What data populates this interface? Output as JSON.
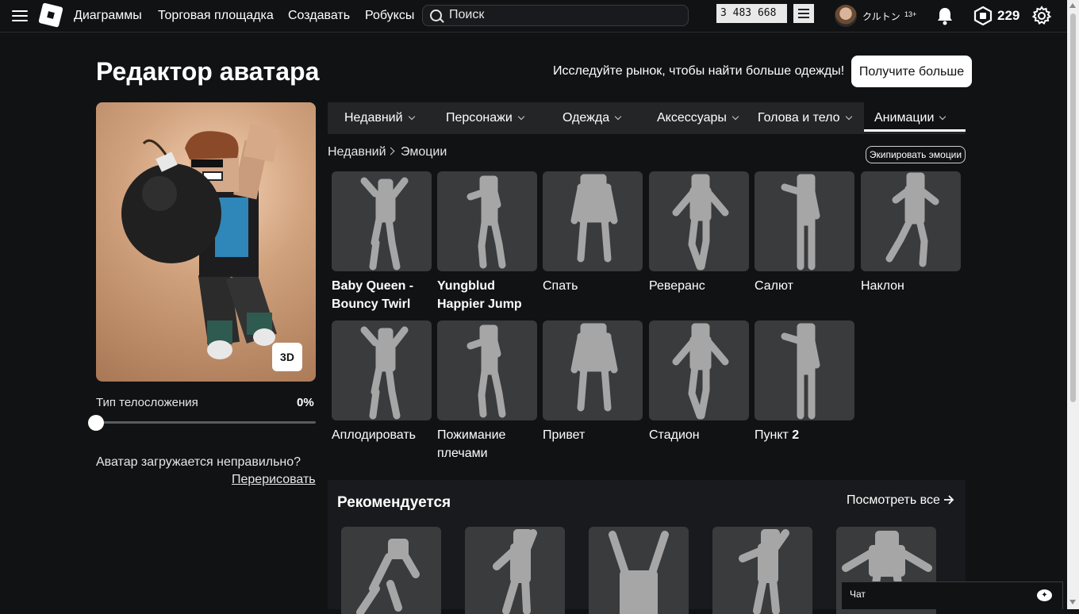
{
  "topbar": {
    "nav": [
      "Диаграммы",
      "Торговая площадка",
      "Создавать",
      "Робуксы"
    ],
    "search_placeholder": "Поиск",
    "counter_value": "3 483 668",
    "username": "クルトン",
    "age_badge": "13+",
    "robux": "229"
  },
  "page": {
    "title": "Редактор аватара",
    "market_text": "Исследуйте рынок, чтобы найти больше одежды!",
    "get_more_label": "Получите больше"
  },
  "preview": {
    "button_3d": "3D",
    "body_type_label": "Тип телосложения",
    "body_type_value": "0%",
    "body_type_fraction": 0,
    "loading_text": "Аватар загружается неправильно?",
    "redraw_link": "Перерисовать"
  },
  "tabs": [
    "Недавний",
    "Персонажи",
    "Одежда",
    "Аксессуары",
    "Голова и тело",
    "Анимации"
  ],
  "active_tab": "Анимации",
  "breadcrumb": [
    "Недавний",
    "Эмоции"
  ],
  "equip_button": "Экипировать эмоции",
  "items": [
    {
      "line1": "Baby Queen -",
      "line2": "Bouncy Twirl",
      "bold": true
    },
    {
      "line1": "Yungblud",
      "line2": "Happier Jump",
      "bold": true
    },
    {
      "line1": "Спать",
      "line2": "",
      "bold": false
    },
    {
      "line1": "Реверанс",
      "line2": "",
      "bold": false
    },
    {
      "line1": "Салют",
      "line2": "",
      "bold": false
    },
    {
      "line1": "Наклон",
      "line2": "",
      "bold": false
    },
    {
      "line1": "Аплодировать",
      "line2": "",
      "bold": false
    },
    {
      "line1": "Пожимание",
      "line2": "плечами",
      "bold": false
    },
    {
      "line1": "Привет",
      "line2": "",
      "bold": false
    },
    {
      "line1": "Стадион",
      "line2": "",
      "bold": false
    },
    {
      "line1": "Пункт",
      "line2": "2",
      "bold": false
    }
  ],
  "recommended": {
    "title": "Рекомендуется",
    "see_all": "Посмотреть все"
  },
  "chat": {
    "label": "Чат"
  },
  "colors": {
    "background": "#111214",
    "tab_bar": "#232527",
    "card": "#393b3d",
    "figure": "#a6a6a6"
  }
}
